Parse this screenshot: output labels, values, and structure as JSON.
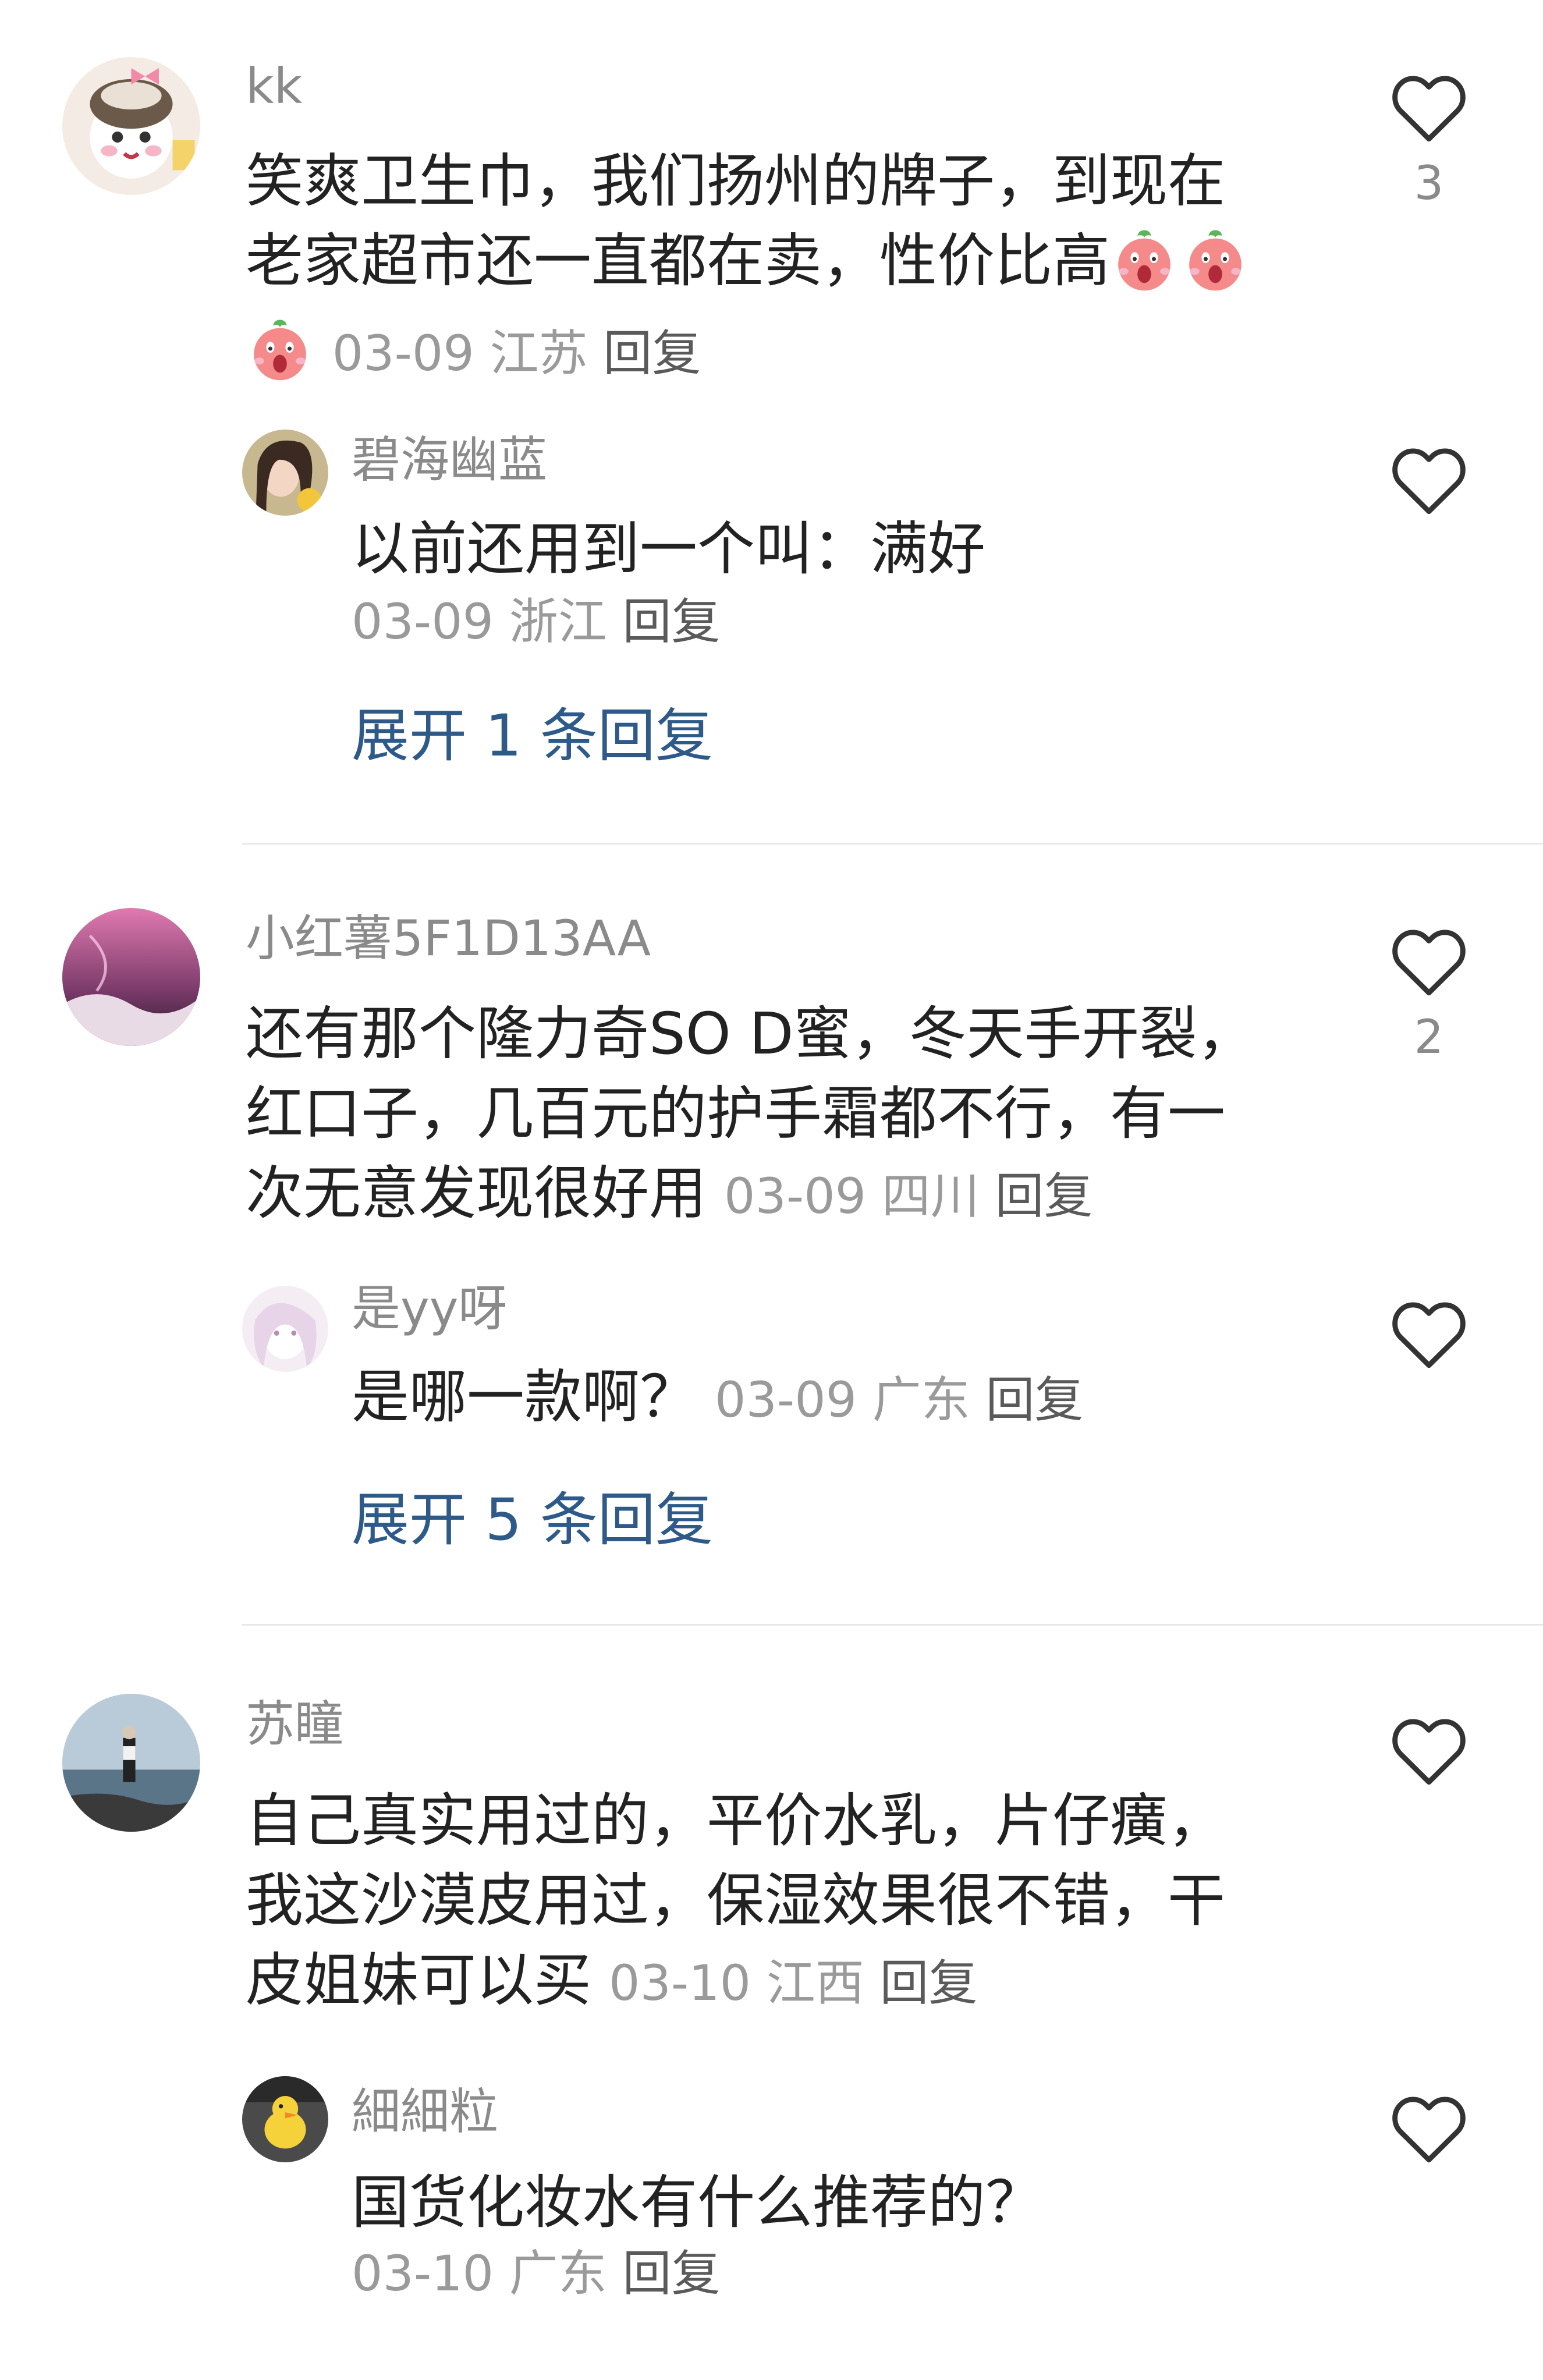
{
  "comments": [
    {
      "username": "kk",
      "lines": [
        "笑爽卫生巾，我们扬州的牌子，到现在",
        "老家超市还一直都在卖，性价比高"
      ],
      "date": "03-09",
      "region": "江苏",
      "reply_label": "回复",
      "likes": "3",
      "sub_reply": {
        "username": "碧海幽蓝",
        "text": "以前还用到一个叫：满好",
        "date": "03-09",
        "region": "浙江",
        "reply_label": "回复"
      },
      "expand_label": "展开 1 条回复"
    },
    {
      "username": "小红薯5F1D13AA",
      "lines": [
        "还有那个隆力奇SO D蜜，冬天手开裂，",
        "红口子，几百元的护手霜都不行，有一",
        "次无意发现很好用"
      ],
      "date": "03-09",
      "region": "四川",
      "reply_label": "回复",
      "likes": "2",
      "sub_reply": {
        "username": "是yy呀",
        "text": "是哪一款啊？",
        "date": "03-09",
        "region": "广东",
        "reply_label": "回复"
      },
      "expand_label": "展开 5 条回复"
    },
    {
      "username": "苏瞳",
      "lines": [
        "自己真实用过的，平价水乳，片仔癀，",
        "我这沙漠皮用过，保湿效果很不错，干",
        "皮姐妹可以买"
      ],
      "date": "03-10",
      "region": "江西",
      "reply_label": "回复",
      "likes": "",
      "sub_reply": {
        "username": "細細粒",
        "text": "国货化妆水有什么推荐的？",
        "date": "03-10",
        "region": "广东",
        "reply_label": "回复"
      }
    }
  ],
  "icons": {
    "like": "heart-outline-icon",
    "emoji": "peach-scream-emoji"
  },
  "colors": {
    "text": "#222222",
    "meta": "#9a9a9a",
    "username": "#8a8a8a",
    "expand_link": "#2e5a8a",
    "divider": "#e8e8e8"
  }
}
